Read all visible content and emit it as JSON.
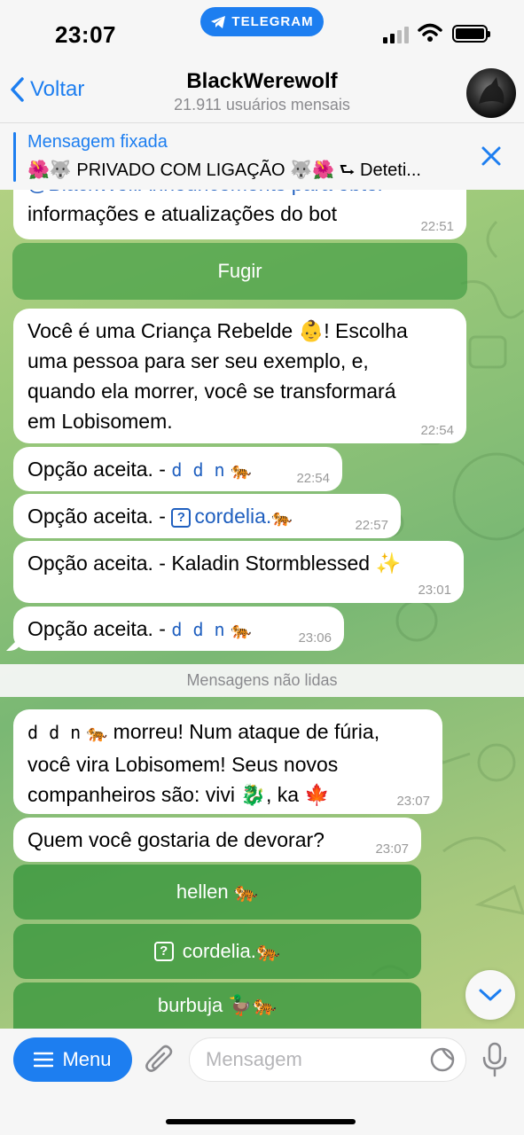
{
  "status": {
    "time": "23:07",
    "app_pill": "TELEGRAM"
  },
  "header": {
    "back_label": "Voltar",
    "title": "BlackWerewolf",
    "subtitle": "21.911 usuários mensais"
  },
  "pinned": {
    "title": "Mensagem fixada",
    "text": "🌺🐺 PRIVADO COM LIGAÇÃO 🐺🌺 ⮑ Deteti..."
  },
  "messages": {
    "m0": {
      "line1": "@BlackWolfAnnouncements para obter",
      "line2": "informações e atualizações do bot",
      "time": "22:51"
    },
    "flee_button": "Fugir",
    "m1": {
      "l1": "Você é uma Criança Rebelde 👶! Escolha",
      "l2": "uma pessoa para ser seu exemplo, e,",
      "l3": "quando ela morrer, você se transformará",
      "l4": "em Lobisomem.",
      "time": "22:54"
    },
    "m2": {
      "prefix": "Opção aceita. - ",
      "name": "d d n",
      "emoji": "🐅",
      "time": "22:54"
    },
    "m3": {
      "prefix": "Opção aceita. - ",
      "box": "?",
      "name": "cordelia.",
      "emoji": "🐅",
      "time": "22:57"
    },
    "m4": {
      "text": "Opção aceita. - Kaladin Stormblessed ✨",
      "time": "23:01"
    },
    "m5": {
      "prefix": "Opção aceita. - ",
      "name": "d d n",
      "emoji": "🐅",
      "time": "23:06"
    },
    "unread_divider": "Mensagens não lidas",
    "m6": {
      "name": "d d n",
      "emoji": "🐅",
      "l1_rest": " morreu! Num ataque de fúria,",
      "l2": "você vira Lobisomem! Seus novos",
      "l3": "companheiros são: vivi 🐉, ka 🍁",
      "time": "23:07"
    },
    "m7": {
      "text": "Quem você gostaria de devorar?",
      "time": "23:07"
    }
  },
  "keyboard": [
    {
      "label": "hellen 🐅"
    },
    {
      "box": "?",
      "label": "cordelia.🐅"
    },
    {
      "label": "burbuja 🦆🐅"
    }
  ],
  "composer": {
    "menu_label": "Menu",
    "placeholder": "Mensagem"
  },
  "colors": {
    "accent": "#1d7ef0",
    "keyboard_button": "#37963c"
  },
  "icons": [
    "telegram-icon",
    "signal-icon",
    "wifi-icon",
    "battery-icon",
    "back-chevron-icon",
    "close-icon",
    "chevron-down-icon",
    "hamburger-icon",
    "paperclip-icon",
    "sticker-icon",
    "microphone-icon"
  ]
}
